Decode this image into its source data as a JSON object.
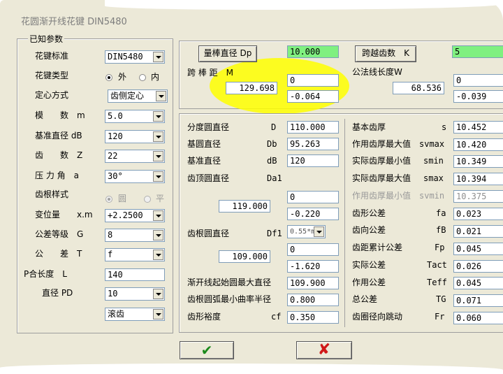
{
  "window": {
    "title": "花圆渐开线花键 DIN5480"
  },
  "known_params": {
    "legend": "已知参数",
    "spline_standard": {
      "label": "花键标准",
      "value": "DIN5480"
    },
    "spline_type": {
      "label": "花键类型",
      "opt_ext": "外",
      "opt_int": "内",
      "selected": "外"
    },
    "centering": {
      "label": "定心方式",
      "value": "齿侧定心"
    },
    "module": {
      "label": "模　　数　m",
      "value": "5.0"
    },
    "ref_dia": {
      "label": "基准直径 dB",
      "value": "120"
    },
    "teeth": {
      "label": "齿　　数　Z",
      "value": "22"
    },
    "pressure_angle": {
      "label": "压 力 角　a",
      "value": "30°"
    },
    "root_style": {
      "label": "齿根样式",
      "opt_round": "圆",
      "opt_flat": "平"
    },
    "profile_shift": {
      "label": "变位量　　x.m",
      "value": "+2.2500"
    },
    "tolerance_grade": {
      "label": "公差等级　G",
      "value": "8"
    },
    "tolerance": {
      "label": "公　　差　T",
      "value": "f"
    },
    "engage_length": {
      "label": "P合长度　L",
      "value": "140"
    },
    "pd": {
      "label": "直径 PD",
      "value": "10"
    },
    "process": {
      "value": "滚齿"
    }
  },
  "measure": {
    "pin_dia_btn": "量棒直径 Dp",
    "pin_dia_value": "10.000",
    "over_pin_label": "跨 棒 距　M",
    "over_pin_value": "129.698",
    "over_pin_upper": "0",
    "over_pin_lower": "-0.064",
    "span_teeth_btn": "跨越齿数　K",
    "span_teeth_value": "5",
    "base_tangent_label": "公法线长度W",
    "base_tangent_value": "68.536",
    "base_tangent_upper": "0",
    "base_tangent_lower": "-0.039"
  },
  "results_left": {
    "pitch_dia": {
      "label": "分度圆直径",
      "sym": "D",
      "value": "110.000"
    },
    "base_dia": {
      "label": "基圆直径",
      "sym": "Db",
      "value": "95.263"
    },
    "ref_dia": {
      "label": "基准直径",
      "sym": "dB",
      "value": "120"
    },
    "tip_dia": {
      "label": "齿顶圆直径",
      "sym": "Da1",
      "value": "119.000",
      "upper": "0",
      "lower": "-0.220"
    },
    "root_dia": {
      "label": "齿根圆直径",
      "sym": "Df1",
      "select": "0.55*m",
      "value": "109.000",
      "upper": "0",
      "lower": "-1.620"
    },
    "form_dia": {
      "label": "渐开线起始圆最大直径",
      "value": "109.900"
    },
    "root_radius": {
      "label": "齿根圆弧最小曲率半径",
      "value": "0.800"
    },
    "clearance": {
      "label": "齿形裕度",
      "sym": "cf",
      "value": "0.350"
    }
  },
  "results_right": {
    "basic_thickness": {
      "label": "基本齿厚",
      "sym": "s",
      "value": "10.452"
    },
    "eff_max": {
      "label": "作用齿厚最大值",
      "sym": "svmax",
      "value": "10.420"
    },
    "act_min": {
      "label": "实际齿厚最小值",
      "sym": "smin",
      "value": "10.349"
    },
    "act_max": {
      "label": "实际齿厚最大值",
      "sym": "smax",
      "value": "10.394"
    },
    "eff_min": {
      "label": "作用齿厚最小值",
      "sym": "svmin",
      "value": "10.375"
    },
    "profile_tol": {
      "label": "齿形公差",
      "sym": "fa",
      "value": "0.023"
    },
    "lead_tol": {
      "label": "齿向公差",
      "sym": "fB",
      "value": "0.021"
    },
    "pitch_tol": {
      "label": "齿距累计公差",
      "sym": "Fp",
      "value": "0.045"
    },
    "actual_tol": {
      "label": "实际公差",
      "sym": "Tact",
      "value": "0.026"
    },
    "effective_tol": {
      "label": "作用公差",
      "sym": "Teff",
      "value": "0.045"
    },
    "total_tol": {
      "label": "总公差",
      "sym": "TG",
      "value": "0.071"
    },
    "runout": {
      "label": "齿圈径向跳动",
      "sym": "Fr",
      "value": "0.060"
    }
  },
  "buttons": {
    "ok": "✔",
    "cancel": "✘"
  },
  "colors": {
    "ok": "#1c8a1c",
    "cancel": "#d01818",
    "highlight": "#ffff00",
    "field_green": "#80f080"
  }
}
